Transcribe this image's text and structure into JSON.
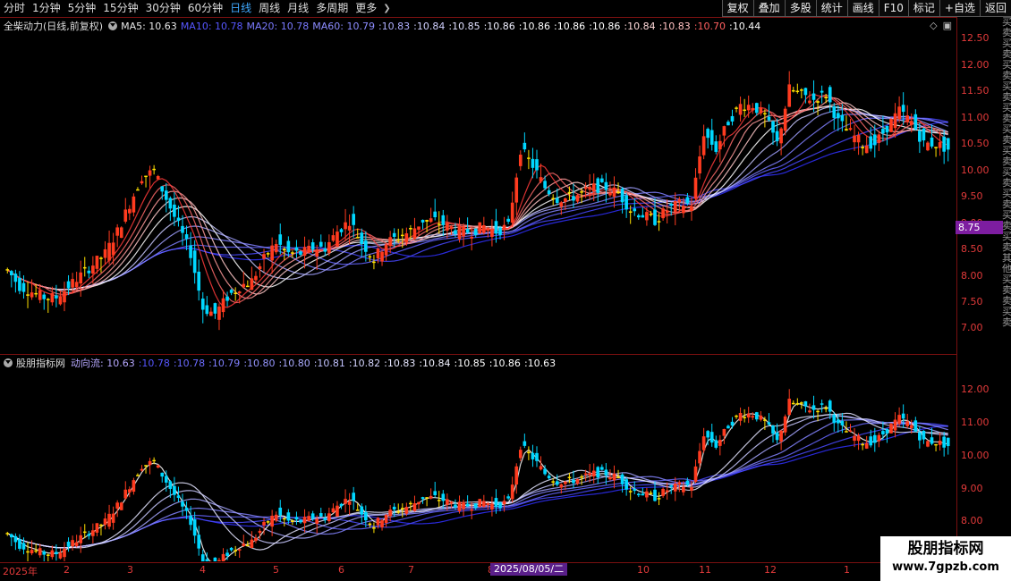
{
  "toolbar": {
    "periods": [
      "分时",
      "1分钟",
      "5分钟",
      "15分钟",
      "30分钟",
      "60分钟",
      "日线",
      "周线",
      "月线",
      "多周期",
      "更多"
    ],
    "active_period": "日线",
    "more_icon": "chevron-right-icon",
    "tools": [
      "复权",
      "叠加",
      "多股",
      "统计",
      "画线",
      "F10",
      "标记",
      "+自选",
      "返回"
    ]
  },
  "main_panel": {
    "indicator_name": "全柴动力(日线,前复权)",
    "ma_labels": [
      "MA5: 10.63",
      "MA10: 10.78",
      "MA20: 10.78",
      "MA60: 10.79"
    ],
    "extra_values": [
      ":10.83",
      ":10.84",
      ":10.85",
      ":10.86",
      ":10.86",
      ":10.86",
      ":10.86",
      ":10.84",
      ":10.83",
      ":10.70",
      ":10.44"
    ],
    "y_ticks": [
      "12.50",
      "12.00",
      "11.50",
      "11.00",
      "10.50",
      "10.00",
      "9.50",
      "9.00",
      "8.50",
      "8.00",
      "7.50",
      "7.00"
    ],
    "current_price": "8.75"
  },
  "sub_panel": {
    "indicator_name": "股朋指标网",
    "line_label": "动向流: 10.63",
    "values": [
      ":10.78",
      ":10.78",
      ":10.79",
      ":10.80",
      ":10.80",
      ":10.81",
      ":10.82",
      ":10.83",
      ":10.84",
      ":10.85",
      ":10.86",
      ":10.63"
    ],
    "y_ticks": [
      "12.00",
      "11.00",
      "10.00",
      "9.00",
      "8.00"
    ]
  },
  "x_axis": {
    "labels": [
      "2025年",
      "2",
      "3",
      "4",
      "5",
      "6",
      "7",
      "8",
      "10",
      "11",
      "12",
      "1"
    ],
    "cursor_date": "2025/08/05/二"
  },
  "side_strip_text": "买卖买卖买卖买卖买卖买卖买卖买卖买卖买卖买卖其他买卖卖买卖",
  "watermark": {
    "title": "股朋指标网",
    "url": "www.7gpzb.com"
  },
  "colors": {
    "up": "#ff3b1f",
    "down": "#00d7ff",
    "flat": "#ffe000",
    "axis": "#e23a3a",
    "grid": "#7a1010",
    "accent": "#3fa9ff"
  },
  "chart_data": {
    "type": "candlestick",
    "x_label_months": [
      "2025-01",
      "2025-02",
      "2025-03",
      "2025-04",
      "2025-05",
      "2025-06",
      "2025-07",
      "2025-08",
      "2025-10",
      "2025-11",
      "2025-12",
      "2026-01"
    ],
    "close_series": [
      8.3,
      8.0,
      7.9,
      7.8,
      7.8,
      8.0,
      8.2,
      8.4,
      8.6,
      9.0,
      9.5,
      10.0,
      10.1,
      9.6,
      9.1,
      8.6,
      7.6,
      7.5,
      7.8,
      8.0,
      8.1,
      8.5,
      8.8,
      8.6,
      8.6,
      8.7,
      8.7,
      9.0,
      9.2,
      8.8,
      8.5,
      8.8,
      8.9,
      9.0,
      9.2,
      9.2,
      9.1,
      9.0,
      9.0,
      9.1,
      9.0,
      9.1,
      10.5,
      10.2,
      9.8,
      9.6,
      9.6,
      9.7,
      9.8,
      9.8,
      9.7,
      9.4,
      9.3,
      9.2,
      9.4,
      9.5,
      9.5,
      10.8,
      10.5,
      11.0,
      11.3,
      11.3,
      11.1,
      10.6,
      11.6,
      11.5,
      11.4,
      11.5,
      11.0,
      10.8,
      10.6,
      10.6,
      10.9,
      11.2,
      11.0,
      10.6,
      10.6,
      10.5
    ],
    "ylim": [
      6.8,
      12.6
    ],
    "sub_ylim": [
      7.6,
      12.4
    ]
  }
}
